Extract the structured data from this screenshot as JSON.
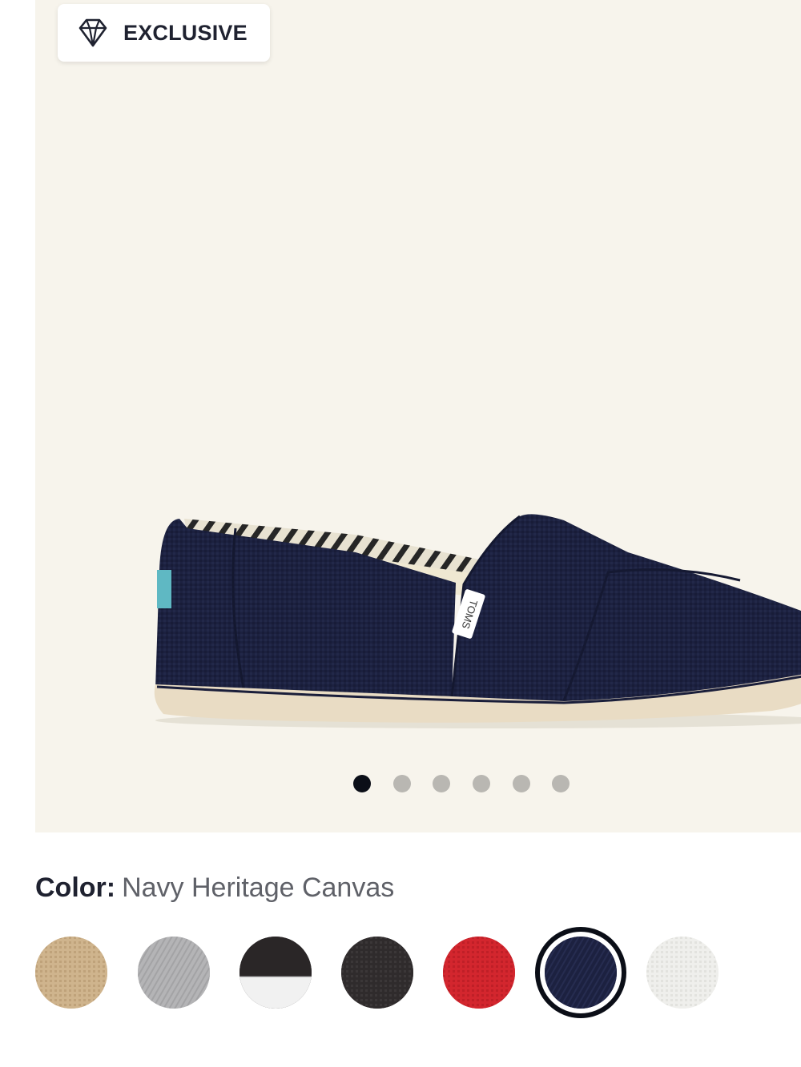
{
  "badge": {
    "label": "EXCLUSIVE",
    "icon": "diamond-icon"
  },
  "product_image": {
    "tag_text": "TOMS",
    "shoe_color": "#1c2140",
    "sole_color": "#e9dcc4",
    "background": "#f7f4ec"
  },
  "carousel": {
    "count": 6,
    "active_index": 0
  },
  "color": {
    "label": "Color:",
    "value": "Navy Heritage Canvas"
  },
  "swatches": [
    {
      "name": "tan",
      "color": "#cfb48d",
      "selected": false
    },
    {
      "name": "grey",
      "color": "#b4b4b6",
      "selected": false
    },
    {
      "name": "black-white",
      "color": "#2a2627",
      "color2": "#f1f1f1",
      "selected": false
    },
    {
      "name": "black",
      "color": "#2f2b2c",
      "selected": false
    },
    {
      "name": "red",
      "color": "#d3262e",
      "selected": false
    },
    {
      "name": "navy",
      "color": "#1c2140",
      "selected": true
    },
    {
      "name": "white",
      "color": "#efefec",
      "selected": false
    }
  ]
}
